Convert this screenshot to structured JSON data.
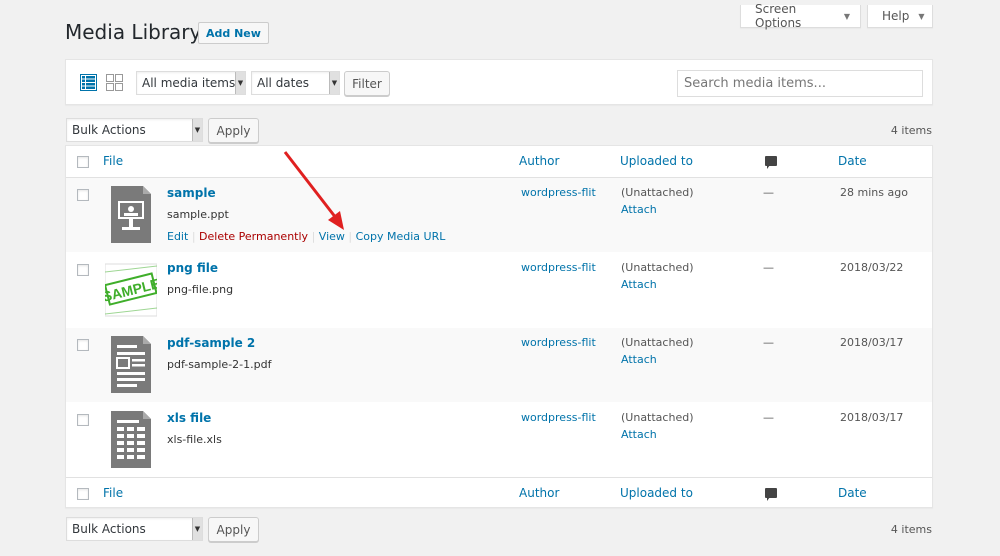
{
  "header": {
    "screen_options": "Screen Options",
    "help": "Help",
    "title": "Media Library",
    "add_new": "Add New"
  },
  "toolbar": {
    "media_filter": "All media items",
    "date_filter": "All dates",
    "filter_button": "Filter",
    "search_placeholder": "Search media items..."
  },
  "bulk": {
    "top_action": "Bulk Actions",
    "apply": "Apply",
    "count": "4 items"
  },
  "columns": {
    "file": "File",
    "author": "Author",
    "uploaded_to": "Uploaded to",
    "comments_icon": "comment-icon",
    "date": "Date"
  },
  "row_actions": {
    "edit": "Edit",
    "delete": "Delete Permanently",
    "view": "View",
    "copy": "Copy Media URL"
  },
  "rows": [
    {
      "title": "sample",
      "filename": "sample.ppt",
      "author": "wordpress-flit",
      "uploaded": "(Unattached)",
      "attach": "Attach",
      "comments": "—",
      "date": "28 mins ago",
      "icon": "presentation-icon"
    },
    {
      "title": "png file",
      "filename": "png-file.png",
      "author": "wordpress-flit",
      "uploaded": "(Unattached)",
      "attach": "Attach",
      "comments": "—",
      "date": "2018/03/22",
      "icon": "image-thumbnail",
      "thumb_text": "SAMPLE"
    },
    {
      "title": "pdf-sample 2",
      "filename": "pdf-sample-2-1.pdf",
      "author": "wordpress-flit",
      "uploaded": "(Unattached)",
      "attach": "Attach",
      "comments": "—",
      "date": "2018/03/17",
      "icon": "document-icon"
    },
    {
      "title": "xls file",
      "filename": "xls-file.xls",
      "author": "wordpress-flit",
      "uploaded": "(Unattached)",
      "attach": "Attach",
      "comments": "—",
      "date": "2018/03/17",
      "icon": "spreadsheet-icon"
    }
  ],
  "colors": {
    "link": "#0073aa",
    "delete": "#aa0000",
    "annotation_arrow": "#e02020",
    "thumb_green": "#3fae2a"
  }
}
